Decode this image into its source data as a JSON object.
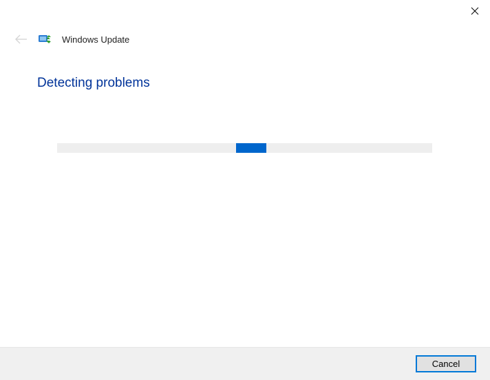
{
  "header": {
    "app_title": "Windows Update"
  },
  "main": {
    "heading": "Detecting problems"
  },
  "footer": {
    "cancel_label": "Cancel"
  },
  "colors": {
    "accent": "#0066cc",
    "heading": "#003399",
    "focus_border": "#0078d7"
  }
}
